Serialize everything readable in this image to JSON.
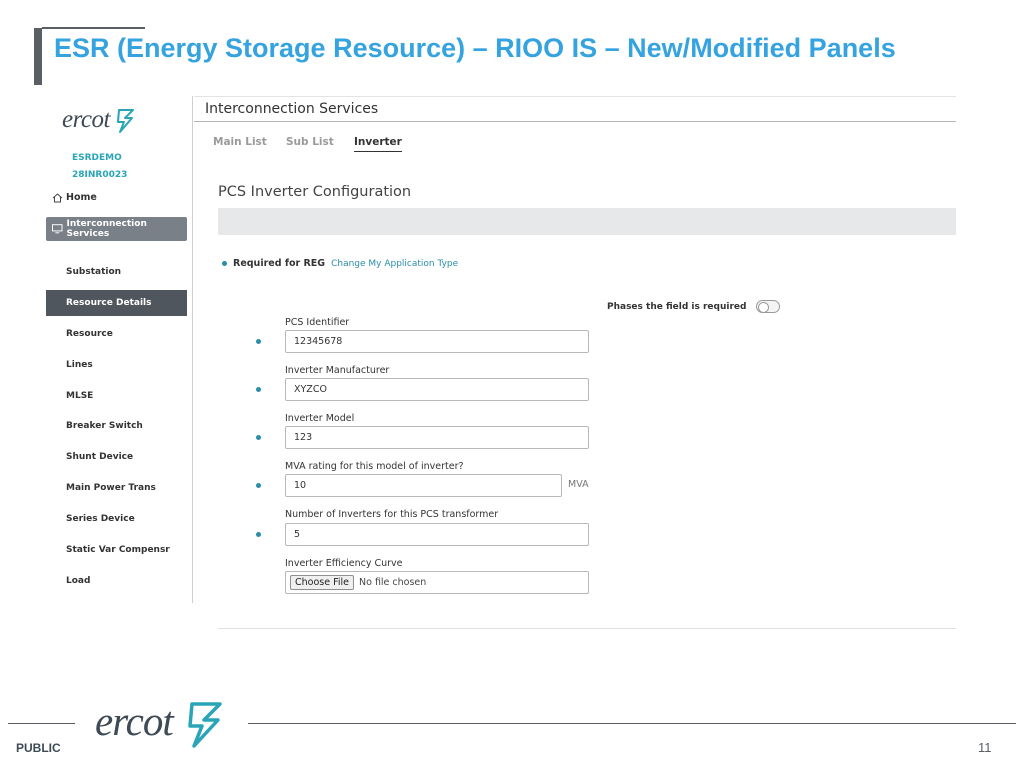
{
  "slide": {
    "title": "ESR (Energy Storage Resource) – RIOO IS – New/Modified Panels",
    "footer_label": "PUBLIC",
    "page_number": "11",
    "footer_logo_text": "ercot"
  },
  "app": {
    "logo_text": "ercot",
    "org_name": "ESRDEMO",
    "org_code": "28INR0023",
    "nav": {
      "home": "Home",
      "interconnection_services": "Interconnection Services",
      "items": [
        "Substation",
        "Resource Details",
        "Resource",
        "Lines",
        "MLSE",
        "Breaker Switch",
        "Shunt Device",
        "Main Power Trans",
        "Series Device",
        "Static Var Compensr",
        "Load"
      ],
      "active_item": "Resource Details"
    },
    "header_title": "Interconnection Services",
    "tabs": [
      "Main List",
      "Sub List",
      "Inverter"
    ],
    "active_tab": "Inverter",
    "section_title": "PCS Inverter Configuration",
    "required_label": "Required for REG",
    "change_link": "Change My Application Type",
    "phases_label": "Phases the field is required",
    "phases_toggle_on": false,
    "fields": [
      {
        "label": "PCS Identifier",
        "value": "12345678"
      },
      {
        "label": "Inverter Manufacturer",
        "value": "XYZCO"
      },
      {
        "label": "Inverter Model",
        "value": "123"
      },
      {
        "label": "MVA rating for this model of inverter?",
        "value": "10",
        "unit": "MVA"
      },
      {
        "label": "Number of Inverters for this PCS transformer",
        "value": "5"
      }
    ],
    "file_field": {
      "label": "Inverter Efficiency Curve",
      "button": "Choose File",
      "status": "No file chosen"
    },
    "accent_color": "#2a8ea8"
  }
}
